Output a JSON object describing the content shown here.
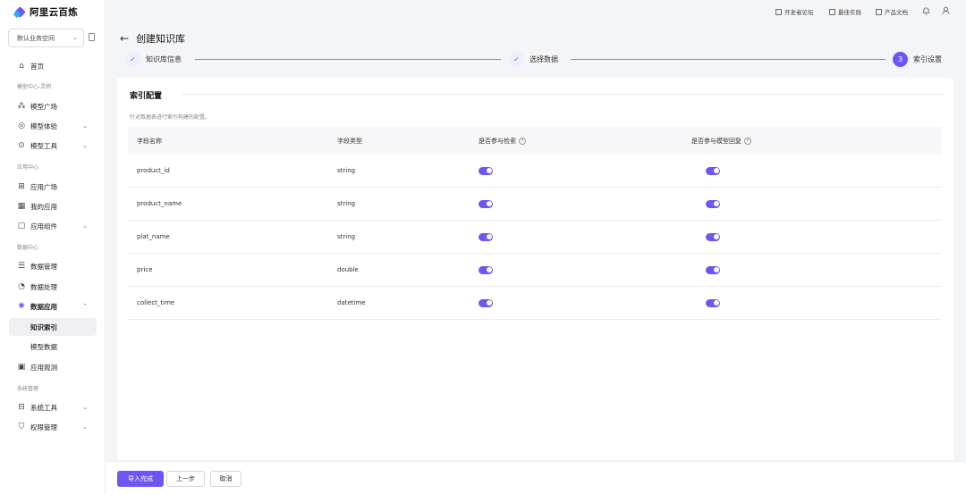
{
  "app": {
    "name": "阿里云百炼"
  },
  "workspace": {
    "label": "默认业务空间"
  },
  "top_links": [
    {
      "label": "开发者论坛",
      "icon": "forum-icon"
    },
    {
      "label": "最佳实践",
      "icon": "practice-icon"
    },
    {
      "label": "产品文档",
      "icon": "doc-icon"
    }
  ],
  "sidebar": {
    "home": "首页",
    "group_model": "模型中心-灵积",
    "model_square": "模型广场",
    "model_experience": "模型体验",
    "model_tools": "模型工具",
    "group_app": "应用中心",
    "app_square": "应用广场",
    "my_apps": "我的应用",
    "app_components": "应用组件",
    "group_data": "数据中心",
    "data_management": "数据管理",
    "data_processing": "数据处理",
    "data_application": "数据应用",
    "knowledge_index": "知识索引",
    "model_data": "模型数据",
    "app_observation": "应用观测",
    "group_system": "系统管理",
    "system_tools": "系统工具",
    "permission_management": "权限管理"
  },
  "page": {
    "title": "创建知识库"
  },
  "steps": [
    {
      "label": "知识库信息",
      "status": "done",
      "mark": "✓"
    },
    {
      "label": "选择数据",
      "status": "done",
      "mark": "✓"
    },
    {
      "label": "索引设置",
      "status": "current",
      "mark": "3"
    }
  ],
  "section": {
    "title": "索引配置",
    "description": "针对数据表进行索引构建的配置。"
  },
  "table": {
    "headers": [
      "字段名称",
      "字段类型",
      "是否参与检索",
      "是否参与模型回复"
    ],
    "rows": [
      {
        "name": "product_id",
        "type": "string",
        "retrieval": true,
        "reply": true
      },
      {
        "name": "product_name",
        "type": "string",
        "retrieval": true,
        "reply": true
      },
      {
        "name": "plat_name",
        "type": "string",
        "retrieval": true,
        "reply": true
      },
      {
        "name": "price",
        "type": "double",
        "retrieval": true,
        "reply": true
      },
      {
        "name": "collect_time",
        "type": "datetime",
        "retrieval": true,
        "reply": true
      }
    ]
  },
  "footer": {
    "finish": "导入完成",
    "prev": "上一步",
    "cancel": "取消"
  },
  "colors": {
    "accent": "#6e56f5"
  }
}
